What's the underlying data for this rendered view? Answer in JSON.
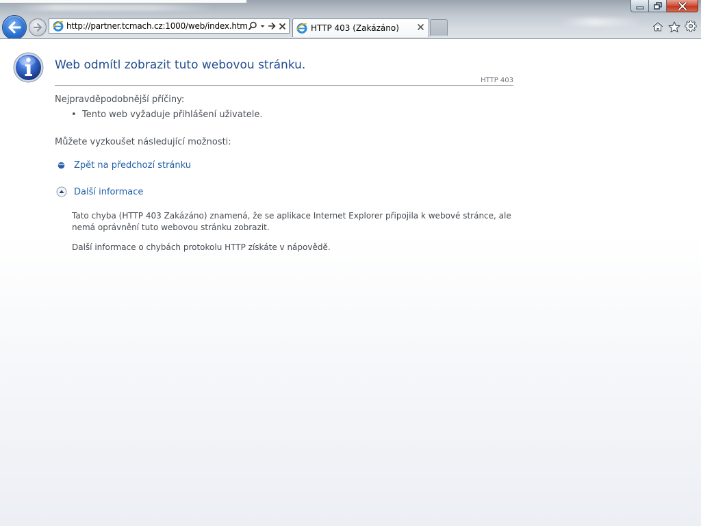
{
  "browser": {
    "address_url": "http://partner.tcmach.cz:1000/web/index.htm",
    "tab_title": "HTTP 403 (Zakázáno)",
    "icons": {
      "back": "back-arrow-icon",
      "forward": "forward-arrow-icon",
      "search": "search-icon",
      "dropdown": "chevron-down-icon",
      "go": "go-arrow-icon",
      "stop": "stop-icon",
      "tab_close": "close-icon",
      "home": "home-icon",
      "favorites": "star-icon",
      "tools": "gear-icon"
    }
  },
  "window_controls": {
    "minimize": "minimize-icon",
    "maximize": "restore-icon",
    "close": "close-icon"
  },
  "page": {
    "title": "Web odmítl zobrazit tuto webovou stránku.",
    "http_code": "HTTP 403",
    "causes_heading": "Nejpravděpodobnější příčiny:",
    "causes": [
      "Tento web vyžaduje přihlášení uživatele."
    ],
    "options_heading": "Můžete vyzkoušet následující možnosti:",
    "back_link": "Zpět na předchozí stránku",
    "more_info_link": "Další informace",
    "details": [
      "Tato chyba (HTTP 403 Zakázáno) znamená, že se aplikace Internet Explorer připojila k webové stránce, ale nemá oprávnění tuto webovou stránku zobrazit.",
      "Další informace o chybách protokolu HTTP získáte v nápovědě."
    ],
    "colors": {
      "title": "#1f4b8e",
      "link": "#1f60a8",
      "body_text": "#4a4f55"
    }
  }
}
